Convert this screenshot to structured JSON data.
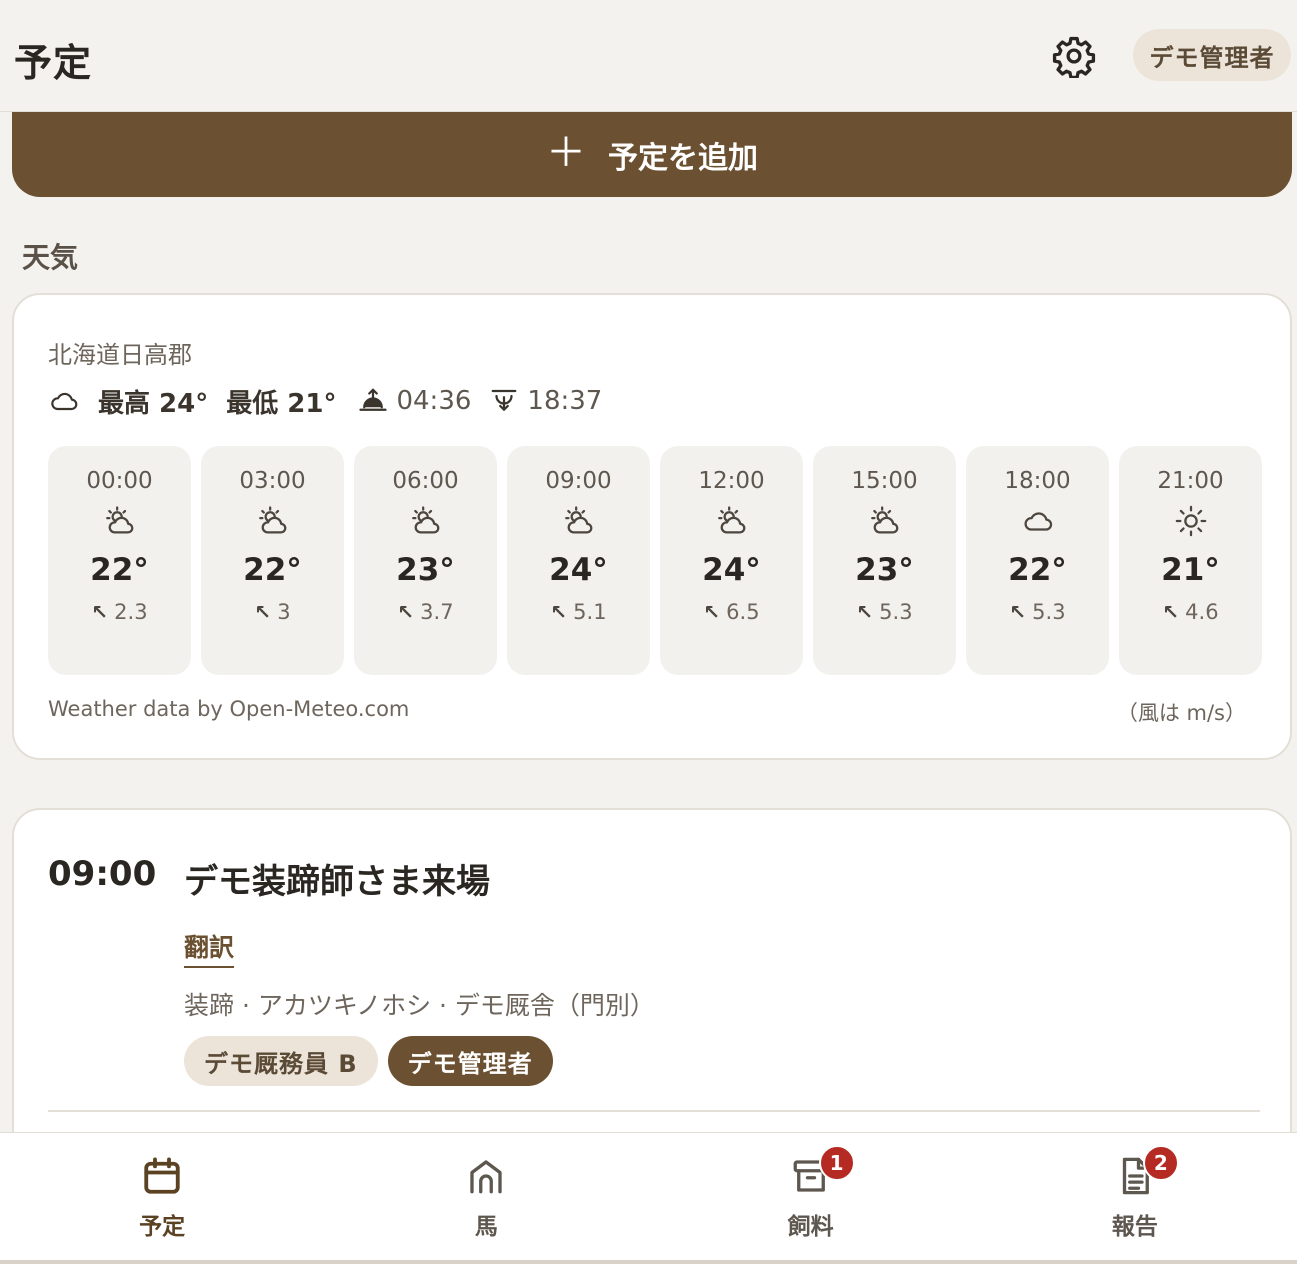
{
  "header": {
    "title": "予定",
    "settings_icon": "gear-icon",
    "user_label": "デモ管理者"
  },
  "add_button": {
    "label": "予定を追加",
    "icon": "plus-icon"
  },
  "weather": {
    "section_title": "天気",
    "location": "北海道日高郡",
    "summary_icon": "cloud-icon",
    "high": "最高 24°",
    "low": "最低 21°",
    "sunrise": "04:36",
    "sunset": "18:37",
    "hours": [
      {
        "time": "00:00",
        "icon": "partly-cloudy-icon",
        "temp": "22°",
        "wind": "2.3"
      },
      {
        "time": "03:00",
        "icon": "partly-cloudy-icon",
        "temp": "22°",
        "wind": "3"
      },
      {
        "time": "06:00",
        "icon": "partly-cloudy-icon",
        "temp": "23°",
        "wind": "3.7"
      },
      {
        "time": "09:00",
        "icon": "partly-cloudy-icon",
        "temp": "24°",
        "wind": "5.1"
      },
      {
        "time": "12:00",
        "icon": "partly-cloudy-icon",
        "temp": "24°",
        "wind": "6.5"
      },
      {
        "time": "15:00",
        "icon": "partly-cloudy-icon",
        "temp": "23°",
        "wind": "5.3"
      },
      {
        "time": "18:00",
        "icon": "cloud-icon",
        "temp": "22°",
        "wind": "5.3"
      },
      {
        "time": "21:00",
        "icon": "sun-icon",
        "temp": "21°",
        "wind": "4.6"
      }
    ],
    "attribution": "Weather data by Open-Meteo.com",
    "wind_unit": "（風は m/s）"
  },
  "schedule": {
    "time": "09:00",
    "title": "デモ装蹄師さま来場",
    "translate_label": "翻訳",
    "meta": "装蹄 · アカツキノホシ · デモ厩舎（門別）",
    "assignees": [
      "デモ厩務員 B",
      "デモ管理者"
    ]
  },
  "nav": {
    "items": [
      {
        "label": "予定",
        "icon": "calendar-icon",
        "active": true
      },
      {
        "label": "馬",
        "icon": "stable-icon",
        "active": false
      },
      {
        "label": "飼料",
        "icon": "feed-box-icon",
        "active": false,
        "badge": "1"
      },
      {
        "label": "報告",
        "icon": "report-icon",
        "active": false,
        "badge": "2"
      }
    ]
  },
  "colors": {
    "accent": "#6b5131",
    "badge": "#b52a22",
    "background": "#f4f2ee"
  }
}
